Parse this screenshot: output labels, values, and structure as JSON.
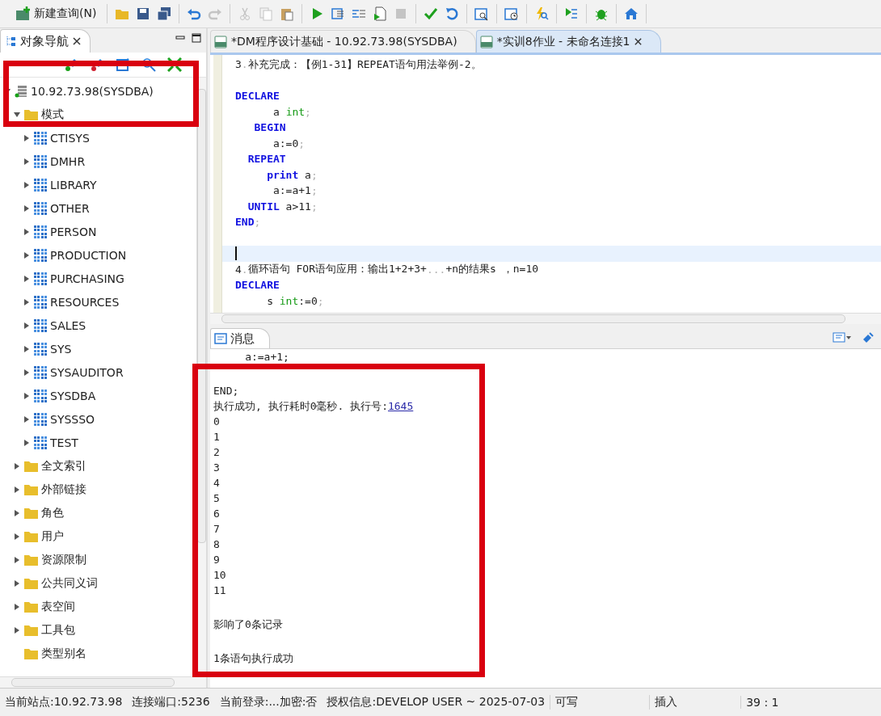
{
  "toolbar": {
    "new_query": "新建查询(N)",
    "groups": [
      [
        {
          "kind": "folder",
          "disabled": false
        },
        {
          "kind": "save",
          "disabled": false
        },
        {
          "kind": "save-all",
          "disabled": false
        }
      ],
      [
        {
          "kind": "undo",
          "disabled": false
        },
        {
          "kind": "redo",
          "disabled": true
        }
      ],
      [
        {
          "kind": "cut",
          "disabled": true
        },
        {
          "kind": "copy",
          "disabled": true
        },
        {
          "kind": "paste",
          "disabled": false
        }
      ],
      [
        {
          "kind": "run",
          "disabled": false
        },
        {
          "kind": "indent",
          "disabled": false
        },
        {
          "kind": "outdent",
          "disabled": false
        },
        {
          "kind": "run-file",
          "disabled": false
        },
        {
          "kind": "stop",
          "disabled": true
        }
      ],
      [
        {
          "kind": "check",
          "disabled": false
        },
        {
          "kind": "refresh",
          "disabled": false
        }
      ],
      [
        {
          "kind": "calendar-search",
          "disabled": false
        }
      ],
      [
        {
          "kind": "calendar-clock",
          "disabled": false
        }
      ],
      [
        {
          "kind": "bolt-search",
          "disabled": false
        }
      ],
      [
        {
          "kind": "branch",
          "disabled": false
        }
      ],
      [
        {
          "kind": "bug",
          "disabled": false
        }
      ],
      [
        {
          "kind": "home",
          "disabled": false
        }
      ]
    ]
  },
  "navigator": {
    "title": "对象导航",
    "tree": [
      {
        "kind": "server",
        "label": "10.92.73.98(SYSDBA)",
        "toggle": true,
        "expanded": true,
        "children": [
          {
            "kind": "folder",
            "label": "模式",
            "toggle": true,
            "expanded": true,
            "children": [
              {
                "kind": "schema",
                "label": "CTISYS",
                "toggle": true,
                "expanded": false
              },
              {
                "kind": "schema",
                "label": "DMHR",
                "toggle": true,
                "expanded": false
              },
              {
                "kind": "schema",
                "label": "LIBRARY",
                "toggle": true,
                "expanded": false
              },
              {
                "kind": "schema",
                "label": "OTHER",
                "toggle": true,
                "expanded": false
              },
              {
                "kind": "schema",
                "label": "PERSON",
                "toggle": true,
                "expanded": false
              },
              {
                "kind": "schema",
                "label": "PRODUCTION",
                "toggle": true,
                "expanded": false
              },
              {
                "kind": "schema",
                "label": "PURCHASING",
                "toggle": true,
                "expanded": false
              },
              {
                "kind": "schema",
                "label": "RESOURCES",
                "toggle": true,
                "expanded": false
              },
              {
                "kind": "schema",
                "label": "SALES",
                "toggle": true,
                "expanded": false
              },
              {
                "kind": "schema",
                "label": "SYS",
                "toggle": true,
                "expanded": false
              },
              {
                "kind": "schema",
                "label": "SYSAUDITOR",
                "toggle": true,
                "expanded": false
              },
              {
                "kind": "schema",
                "label": "SYSDBA",
                "toggle": true,
                "expanded": false
              },
              {
                "kind": "schema",
                "label": "SYSSSO",
                "toggle": true,
                "expanded": false
              },
              {
                "kind": "schema",
                "label": "TEST",
                "toggle": true,
                "expanded": false
              }
            ]
          },
          {
            "kind": "folder",
            "label": "全文索引",
            "toggle": true,
            "expanded": false
          },
          {
            "kind": "folder",
            "label": "外部链接",
            "toggle": true,
            "expanded": false
          },
          {
            "kind": "folder",
            "label": "角色",
            "toggle": true,
            "expanded": false
          },
          {
            "kind": "folder",
            "label": "用户",
            "toggle": true,
            "expanded": false
          },
          {
            "kind": "folder",
            "label": "资源限制",
            "toggle": true,
            "expanded": false
          },
          {
            "kind": "folder",
            "label": "公共同义词",
            "toggle": true,
            "expanded": false
          },
          {
            "kind": "folder",
            "label": "表空间",
            "toggle": true,
            "expanded": false
          },
          {
            "kind": "folder",
            "label": "工具包",
            "toggle": true,
            "expanded": false
          },
          {
            "kind": "folder",
            "label": "类型别名",
            "toggle": false,
            "expanded": false
          }
        ]
      }
    ]
  },
  "editor_tabs": [
    {
      "label": "*DM程序设计基础 - 10.92.73.98(SYSDBA)",
      "selected": false
    },
    {
      "label": "*实训8作业 - 未命名连接1",
      "selected": true
    }
  ],
  "code": [
    {
      "kind": "code",
      "tokens": [
        {
          "kind": "text",
          "text": "3"
        },
        {
          "kind": "punct",
          "text": "."
        },
        {
          "kind": "text",
          "text": "补充完成：【例1-31】REPEAT语句用法举例-2。"
        }
      ]
    },
    {
      "kind": "blank"
    },
    {
      "kind": "code",
      "tokens": [
        {
          "kind": "kw",
          "text": "DECLARE"
        }
      ]
    },
    {
      "kind": "code",
      "tokens": [
        {
          "kind": "text",
          "text": "      a "
        },
        {
          "kind": "type",
          "text": "int"
        },
        {
          "kind": "punct",
          "text": ";"
        }
      ]
    },
    {
      "kind": "code",
      "tokens": [
        {
          "kind": "kw",
          "text": "   BEGIN"
        }
      ]
    },
    {
      "kind": "code",
      "tokens": [
        {
          "kind": "text",
          "text": "      a:=0"
        },
        {
          "kind": "punct",
          "text": ";"
        }
      ]
    },
    {
      "kind": "code",
      "tokens": [
        {
          "kind": "kw",
          "text": "  REPEAT"
        }
      ]
    },
    {
      "kind": "code",
      "tokens": [
        {
          "kind": "kw",
          "text": "     print"
        },
        {
          "kind": "text",
          "text": " a"
        },
        {
          "kind": "punct",
          "text": ";"
        }
      ]
    },
    {
      "kind": "code",
      "tokens": [
        {
          "kind": "text",
          "text": "      a:=a+1"
        },
        {
          "kind": "punct",
          "text": ";"
        }
      ]
    },
    {
      "kind": "code",
      "tokens": [
        {
          "kind": "kw",
          "text": "  UNTIL"
        },
        {
          "kind": "text",
          "text": " a>11"
        },
        {
          "kind": "punct",
          "text": ";"
        }
      ]
    },
    {
      "kind": "code",
      "tokens": [
        {
          "kind": "kw",
          "text": "END"
        },
        {
          "kind": "punct",
          "text": ";"
        }
      ]
    },
    {
      "kind": "blank"
    },
    {
      "kind": "cursor"
    },
    {
      "kind": "code",
      "tokens": [
        {
          "kind": "text",
          "text": "4"
        },
        {
          "kind": "punct",
          "text": "."
        },
        {
          "kind": "text",
          "text": "循环语句 FOR语句应用：输出1+2+3+"
        },
        {
          "kind": "punct",
          "text": "..."
        },
        {
          "kind": "text",
          "text": "+n的结果s ，n=10"
        }
      ]
    },
    {
      "kind": "code",
      "tokens": [
        {
          "kind": "kw",
          "text": "DECLARE"
        }
      ]
    },
    {
      "kind": "code",
      "tokens": [
        {
          "kind": "text",
          "text": "     s "
        },
        {
          "kind": "type",
          "text": "int"
        },
        {
          "kind": "text",
          "text": ":=0"
        },
        {
          "kind": "punct",
          "text": ";"
        }
      ]
    }
  ],
  "messages": {
    "title": "消息",
    "lines": [
      {
        "kind": "text",
        "text": "     a:=a+1;"
      },
      {
        "kind": "blank"
      },
      {
        "kind": "text",
        "text": "END;"
      },
      {
        "kind": "result",
        "text": "执行成功, 执行耗时0毫秒. 执行号:",
        "link": "1645"
      },
      {
        "kind": "text",
        "text": "0"
      },
      {
        "kind": "text",
        "text": "1"
      },
      {
        "kind": "text",
        "text": "2"
      },
      {
        "kind": "text",
        "text": "3"
      },
      {
        "kind": "text",
        "text": "4"
      },
      {
        "kind": "text",
        "text": "5"
      },
      {
        "kind": "text",
        "text": "6"
      },
      {
        "kind": "text",
        "text": "7"
      },
      {
        "kind": "text",
        "text": "8"
      },
      {
        "kind": "text",
        "text": "9"
      },
      {
        "kind": "text",
        "text": "10"
      },
      {
        "kind": "text",
        "text": "11"
      },
      {
        "kind": "blank"
      },
      {
        "kind": "text",
        "text": "影响了0条记录"
      },
      {
        "kind": "blank"
      },
      {
        "kind": "text",
        "text": "1条语句执行成功"
      }
    ]
  },
  "status_bar": [
    "当前站点:10.92.73.98",
    "连接端口:5236",
    "当前登录:...加密:否",
    "授权信息:DEVELOP USER ~ 2025-07-03",
    "可写",
    "插入",
    "39 : 1"
  ]
}
